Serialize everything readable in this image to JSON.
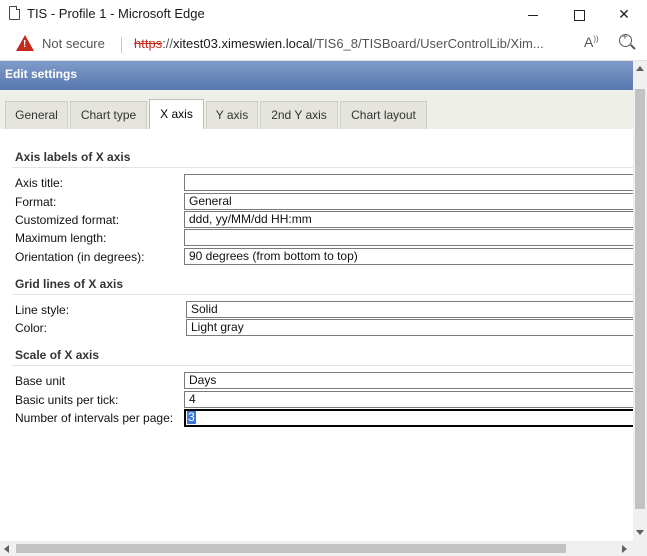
{
  "window": {
    "title": "TIS - Profile 1 - Microsoft Edge",
    "icon": "page-icon"
  },
  "address_bar": {
    "security_label": "Not secure",
    "url_scheme": "https",
    "url_rest_prefix": "://",
    "url_host": "xitest03.ximeswien.local",
    "url_path": "/TIS6_8/TISBoard/UserControlLib/Xim...",
    "read_aloud_label": "A",
    "read_aloud_sup": "))"
  },
  "dialog": {
    "title": "Edit settings"
  },
  "tabs": [
    {
      "label": "General",
      "active": false
    },
    {
      "label": "Chart type",
      "active": false
    },
    {
      "label": "X axis",
      "active": true
    },
    {
      "label": "Y axis",
      "active": false
    },
    {
      "label": "2nd Y axis",
      "active": false
    },
    {
      "label": "Chart layout",
      "active": false
    }
  ],
  "sections": {
    "axis_labels": {
      "heading": "Axis labels of X axis",
      "fields": [
        {
          "label": "Axis title:",
          "value": ""
        },
        {
          "label": "Format:",
          "value": "General"
        },
        {
          "label": "Customized format:",
          "value": "ddd, yy/MM/dd HH:mm"
        },
        {
          "label": "Maximum length:",
          "value": ""
        },
        {
          "label": "Orientation (in degrees):",
          "value": "90 degrees (from bottom to top)"
        }
      ]
    },
    "grid_lines": {
      "heading": "Grid lines of X axis",
      "fields": [
        {
          "label": "Line style:",
          "value": "Solid"
        },
        {
          "label": "Color:",
          "value": "Light gray"
        }
      ]
    },
    "scale": {
      "heading": "Scale of X axis",
      "fields": [
        {
          "label": "Base unit",
          "value": "Days"
        },
        {
          "label": "Basic units per tick:",
          "value": "4"
        },
        {
          "label": "Number of intervals per page:",
          "value": "3"
        }
      ]
    }
  },
  "colors": {
    "header_gradient_top": "#7f9cc9",
    "header_gradient_bottom": "#5877b0",
    "selection": "#3b78d8",
    "warning_red": "#c42b1c"
  }
}
